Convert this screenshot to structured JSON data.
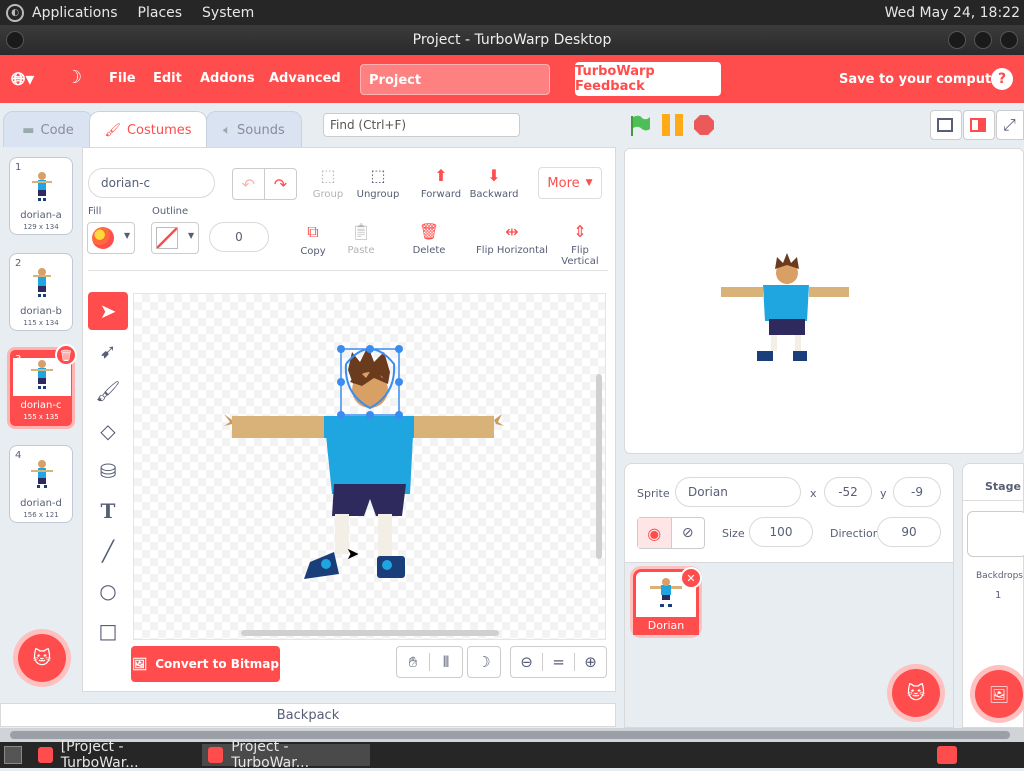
{
  "sysbar": {
    "menus": [
      "Applications",
      "Places",
      "System"
    ],
    "clock": "Wed May 24, 18:22"
  },
  "window": {
    "title": "Project - TurboWarp Desktop"
  },
  "menubar": {
    "file": "File",
    "edit": "Edit",
    "addons": "Addons",
    "advanced": "Advanced",
    "project_title": "Project",
    "feedback": "TurboWarp Feedback",
    "save": "Save to your computer",
    "help": "?"
  },
  "tabs": {
    "code": "Code",
    "costumes": "Costumes",
    "sounds": "Sounds"
  },
  "find": {
    "placeholder": "Find (Ctrl+F)"
  },
  "costumes": [
    {
      "num": "1",
      "name": "dorian-a",
      "size": "129 x 134"
    },
    {
      "num": "2",
      "name": "dorian-b",
      "size": "115 x 134"
    },
    {
      "num": "3",
      "name": "dorian-c",
      "size": "155 x 135"
    },
    {
      "num": "4",
      "name": "dorian-d",
      "size": "156 x 121"
    }
  ],
  "paint": {
    "costume_name": "dorian-c",
    "group": "Group",
    "ungroup": "Ungroup",
    "forward": "Forward",
    "backward": "Backward",
    "more": "More",
    "fill": "Fill",
    "outline": "Outline",
    "outline_width": "0",
    "copy": "Copy",
    "paste": "Paste",
    "delete": "Delete",
    "flip_h": "Flip Horizontal",
    "flip_v": "Flip Vertical",
    "convert": "Convert to Bitmap",
    "zoom_reset": "="
  },
  "backpack": "Backpack",
  "sprite": {
    "label": "Sprite",
    "name": "Dorian",
    "x_label": "x",
    "x": "-52",
    "y_label": "y",
    "y": "-9",
    "size_label": "Size",
    "size": "100",
    "dir_label": "Direction",
    "direction": "90",
    "tile_name": "Dorian"
  },
  "stage": {
    "label": "Stage",
    "backdrops_label": "Backdrops",
    "backdrops": "1"
  },
  "taskbar": {
    "item1": "[Project - TurboWar...",
    "item2": "Project - TurboWar..."
  },
  "colors": {
    "accent": "#ff4c4c",
    "green_flag": "#4cbf56",
    "pause": "#ffab19",
    "stop": "#ec5959"
  }
}
